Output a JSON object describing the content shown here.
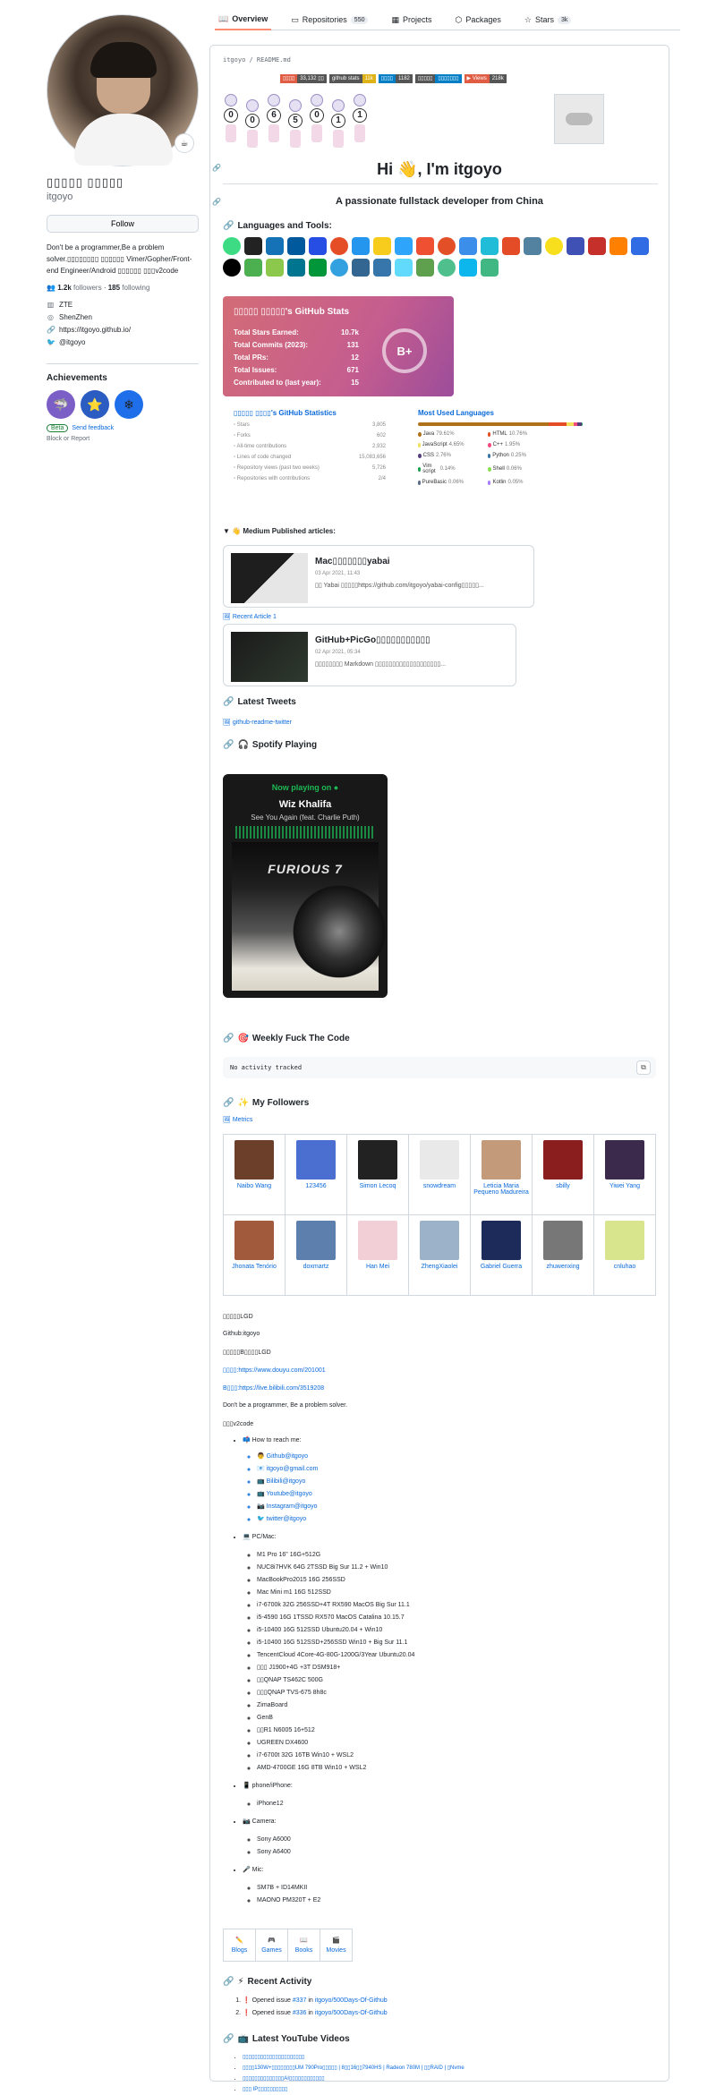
{
  "tabs": [
    {
      "label": "Overview",
      "icon": "book-icon"
    },
    {
      "label": "Repositories",
      "count": "550",
      "icon": "repo-icon"
    },
    {
      "label": "Projects",
      "icon": "table-icon"
    },
    {
      "label": "Packages",
      "icon": "package-icon"
    },
    {
      "label": "Stars",
      "count": "3k",
      "icon": "star-icon"
    }
  ],
  "profile": {
    "fullname": "▯▯▯▯▯ ▯▯▯▯▯",
    "login": "itgoyo",
    "follow_label": "Follow",
    "bio": "Don't be a programmer,Be a problem solver.▯▯▯▯▯▯▯▯ ▯▯▯▯▯▯ Vimer/Gopher/Front-end Engineer/Android ▯▯▯▯▯▯ ▯▯▯v2code",
    "followers": "1.2k",
    "followers_label": "followers",
    "following": "185",
    "following_label": "following",
    "company": "ZTE",
    "location": "ShenZhen",
    "website": "https://itgoyo.github.io/",
    "twitter": "@itgoyo",
    "achievements_title": "Achievements",
    "beta_label": "Beta",
    "feedback_label": "Send feedback",
    "block_label": "Block or Report"
  },
  "readme": {
    "path": "itgoyo / README.md",
    "shields": [
      {
        "left": "▯▯▯▯",
        "right": "33,132 ▯▯",
        "lc": "#e05d44",
        "rc": "#555"
      },
      {
        "left": "github stats",
        "right": "11k",
        "lc": "#555",
        "rc": "#dfb317"
      },
      {
        "left": "▯▯▯▯",
        "right": "1182",
        "lc": "#007ec6",
        "rc": "#555"
      },
      {
        "left": "▯▯▯▯▯",
        "right": "▯▯▯▯▯▯▯",
        "lc": "#555",
        "rc": "#007ec6"
      },
      {
        "left": "▶ Views",
        "right": "218k",
        "lc": "#e05d44",
        "rc": "#555"
      }
    ],
    "counter_digits": [
      "0",
      "0",
      "6",
      "5",
      "0",
      "1",
      "1"
    ],
    "greeting": "Hi 👋, I'm itgoyo",
    "tagline": "A passionate fullstack developer from China",
    "languages_title": "Languages and Tools:",
    "stats_card": {
      "title": "▯▯▯▯▯ ▯▯▯▯▯'s GitHub Stats",
      "rows": [
        {
          "label": "Total Stars Earned:",
          "value": "10.7k"
        },
        {
          "label": "Total Commits (2023):",
          "value": "131"
        },
        {
          "label": "Total PRs:",
          "value": "12"
        },
        {
          "label": "Total Issues:",
          "value": "671"
        },
        {
          "label": "Contributed to (last year):",
          "value": "15"
        }
      ],
      "grade": "B+"
    },
    "metrics": {
      "title": "▯▯▯▯▯ ▯▯▯▯'s GitHub Statistics",
      "rows": [
        {
          "label": "Stars",
          "value": "3,805"
        },
        {
          "label": "Forks",
          "value": "602"
        },
        {
          "label": "All-time contributions",
          "value": "2,932"
        },
        {
          "label": "Lines of code changed",
          "value": "15,083,656"
        },
        {
          "label": "Repository views (past two weeks)",
          "value": "5,726"
        },
        {
          "label": "Repositories with contributions",
          "value": "2/4"
        }
      ],
      "lang_title": "Most Used Languages",
      "langs": [
        {
          "name": "Java",
          "pct": "79.61%",
          "color": "#b07219"
        },
        {
          "name": "HTML",
          "pct": "10.76%",
          "color": "#e34c26"
        },
        {
          "name": "JavaScript",
          "pct": "4.65%",
          "color": "#f1e05a"
        },
        {
          "name": "C++",
          "pct": "1.95%",
          "color": "#f34b7d"
        },
        {
          "name": "CSS",
          "pct": "2.76%",
          "color": "#563d7c"
        },
        {
          "name": "Python",
          "pct": "0.25%",
          "color": "#3572A5"
        },
        {
          "name": "Vim script",
          "pct": "0.14%",
          "color": "#199f4b"
        },
        {
          "name": "Shell",
          "pct": "0.06%",
          "color": "#89e051"
        },
        {
          "name": "PureBasic",
          "pct": "0.06%",
          "color": "#5a6986"
        },
        {
          "name": "Kotlin",
          "pct": "0.05%",
          "color": "#A97BFF"
        }
      ]
    },
    "medium_title": "Medium Published articles:",
    "articles": [
      {
        "title": "Mac▯▯▯▯▯▯▯yabai",
        "date": "03 Apr 2021, 11:43",
        "excerpt": "▯▯ Yabai ▯▯▯▯▯https://github.com/itgoyo/yabai-config▯▯▯▯▯..."
      },
      {
        "title": "GitHub+PicGo▯▯▯▯▯▯▯▯▯▯▯",
        "date": "02 Apr 2021, 05:34",
        "excerpt": "▯▯▯▯▯▯▯▯ Markdown ▯▯▯▯▯▯▯▯▯▯▯▯▯▯▯▯▯▯▯..."
      }
    ],
    "recent_article_link": "Recent Article 1",
    "tweets_title": "Latest Tweets",
    "twitter_link": "github-readme-twitter",
    "spotify_title": "Spotify Playing",
    "spotify": {
      "now_playing": "Now playing on",
      "artist": "Wiz Khalifa",
      "song": "See You Again (feat. Charlie Puth)",
      "album_text": "FURIOUS 7"
    },
    "wakatime_title": "Weekly Fuck The Code",
    "wakatime_text": "No activity tracked",
    "followers_title": "My Followers",
    "metrics_link": "Metrics",
    "followers": [
      {
        "name": "Naibo Wang",
        "color": "#6b3f2a"
      },
      {
        "name": "123456",
        "color": "#4a6fd1"
      },
      {
        "name": "Simon Lecoq",
        "color": "#222"
      },
      {
        "name": "snowdream",
        "color": "#e9e9e9"
      },
      {
        "name": "Leticia Maria Pequeno Madureira",
        "color": "#c49b7a"
      },
      {
        "name": "sbilly",
        "color": "#8a1d1d"
      },
      {
        "name": "Yiwei Yang",
        "color": "#3c2a4d"
      },
      {
        "name": "Jhonata Tenório",
        "color": "#a25a3c"
      },
      {
        "name": "doxmartz",
        "color": "#5c7fae"
      },
      {
        "name": "Han Mei",
        "color": "#f2cfd7"
      },
      {
        "name": "ZhengXiaolei",
        "color": "#9bb2c9"
      },
      {
        "name": "Gabriel Guerra",
        "color": "#1c2b5a"
      },
      {
        "name": "zhuwenxing",
        "color": "#777"
      },
      {
        "name": "cnluhao",
        "color": "#d9e58c"
      }
    ],
    "plain_lines": [
      "▯▯▯▯▯LGD",
      "Github:itgoyo",
      "▯▯▯▯▯B▯▯▯▯LGD",
      "▯▯▯▯:https://www.douyu.com/201001",
      "B▯▯▯:https://live.bilibili.com/3519208",
      "Don't be a programmer, Be a problem solver.",
      "▯▯▯v2code"
    ],
    "reach_title": "📫 How to reach me:",
    "reach": [
      "👨 Github@itgoyo",
      "📧 itgoyo@gmail.com",
      "📺 Bilibili@itgoyo",
      "📺 Youtube@itgoyo",
      "📷 Instagram@itgoyo",
      "🐦 twitter@itgoyo"
    ],
    "pc_title": "💻 PC/Mac:",
    "pc": [
      "M1 Pro 16\" 16G+512G",
      "NUC8i7HVK 64G 2TSSD Big Sur 11.2 + Win10",
      "MacBookPro2015 16G 256SSD",
      "Mac Mini m1 16G 512SSD",
      "i7-6700k 32G 256SSD+4T RX590 MacOS Big Sur 11.1",
      "i5-4590 16G 1TSSD RX570 MacOS Catalina 10.15.7",
      "i5-10400 16G 512SSD Ubuntu20.04 + Win10",
      "i5-10400 16G 512SSD+256SSD Win10 + Big Sur 11.1",
      "TencentCloud 4Core-4G-80G-1200G/3Year Ubuntu20.04",
      "▯▯▯ J1900+4G +3T DSM918+",
      "▯▯QNAP TS462C 500G",
      "▯▯▯QNAP TVS-675 8h8c",
      "ZimaBoard",
      "GenB",
      "▯▯R1 N6005 16+512",
      "UGREEN DX4600",
      "i7-6700t 32G 16TB Win10 + WSL2",
      "AMD-4700GE 16G 8TB Win10 + WSL2"
    ],
    "phone_title": "📱 phone/iPhone:",
    "phone": [
      "iPhone12"
    ],
    "camera_title": "📷 Camera:",
    "camera": [
      "Sony A6000",
      "Sony A6400"
    ],
    "mic_title": "🎤 Mic:",
    "mic": [
      "SM7B + ID14MKII",
      "MAONO PM320T + E2"
    ],
    "hobbies": [
      {
        "label": "Blogs",
        "icon": "✏️"
      },
      {
        "label": "Games",
        "icon": "🎮"
      },
      {
        "label": "Books",
        "icon": "📖"
      },
      {
        "label": "Movies",
        "icon": "🎬"
      }
    ],
    "activity_title": "Recent Activity",
    "activity": [
      {
        "prefix": "Opened issue",
        "issue": "#337",
        "in": "in",
        "repo": "itgoyo/500Days-Of-Github"
      },
      {
        "prefix": "Opened issue",
        "issue": "#336",
        "in": "in",
        "repo": "itgoyo/500Days-Of-Github"
      }
    ],
    "youtube_title": "Latest YouTube Videos",
    "youtube": [
      "▯▯▯▯▯▯▯▯▯▯▯▯▯▯▯▯▯▯▯▯▯",
      "▯▯▯▯130W+▯▯▯▯▯▯▯▯UM 790Pro▯▯▯▯▯ | 8▯▯16▯▯7940HS | Radeon 780M | ▯▯RAID | ▯Nvme",
      "▯▯▯▯▯▯▯▯▯▯▯▯▯▯AI▯▯▯▯▯▯▯▯▯▯▯▯",
      "▯▯▯ IP▯▯▯▯▯▯▯▯▯▯",
      "▯▯▯HP Gen8▯▯▯▯▯▯▯▯▯▯▯▯▯▯▯▯▯▯▯▯▯"
    ]
  }
}
